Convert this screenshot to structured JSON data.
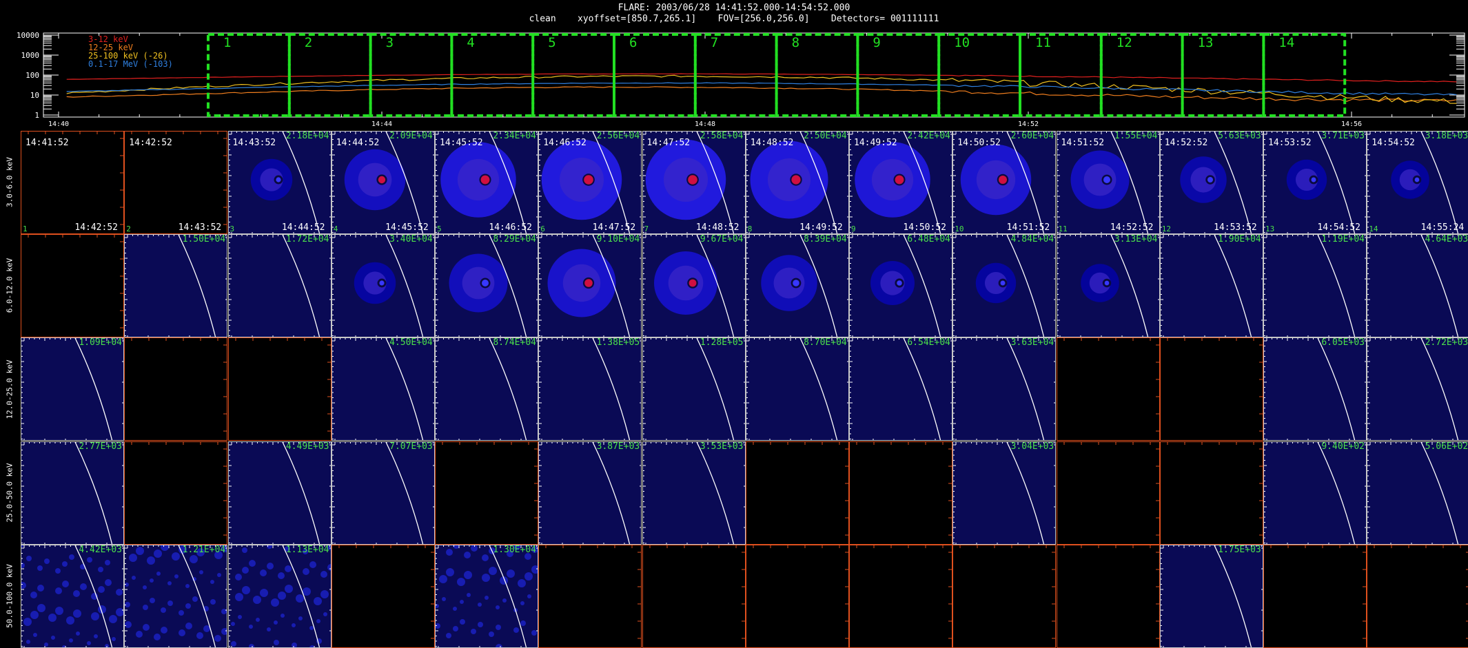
{
  "header": {
    "line1": "FLARE: 2003/06/28 14:41:52.000-14:54:52.000",
    "line2": "clean    xyoffset=[850.7,265.1]    FOV=[256.0,256.0]    Detectors= 001111111"
  },
  "lightcurve": {
    "y_ticks": [
      "10000",
      "1000",
      "100",
      "10",
      "1"
    ],
    "x_ticks": [
      "14:40",
      "14:44",
      "14:48",
      "14:52",
      "14:56"
    ],
    "legend": [
      {
        "label": "3-12 keV",
        "color": "#e0201e"
      },
      {
        "label": "12-25 keV",
        "color": "#f07e1e"
      },
      {
        "label": "25-100 keV (-26)",
        "color": "#f0c020"
      },
      {
        "label": "0.1-17 MeV (-103)",
        "color": "#2f80e0"
      }
    ],
    "interval_color": "#22e022",
    "intervals": [
      "1",
      "2",
      "3",
      "4",
      "5",
      "6",
      "7",
      "8",
      "9",
      "10",
      "11",
      "12",
      "13",
      "14"
    ]
  },
  "rows": [
    {
      "label": "3.0-6.0 keV"
    },
    {
      "label": "6.0-12.0 keV"
    },
    {
      "label": "12.0-25.0 keV"
    },
    {
      "label": "25.0-50.0 keV"
    },
    {
      "label": "50.0-100.0 keV"
    }
  ],
  "time_starts": [
    "14:41:52",
    "14:42:52",
    "14:43:52",
    "14:44:52",
    "14:45:52",
    "14:46:52",
    "14:47:52",
    "14:48:52",
    "14:49:52",
    "14:50:52",
    "14:51:52",
    "14:52:52",
    "14:53:52",
    "14:54:52"
  ],
  "time_ends": [
    "14:42:52",
    "14:43:52",
    "14:44:52",
    "14:45:52",
    "14:46:52",
    "14:47:52",
    "14:48:52",
    "14:49:52",
    "14:50:52",
    "14:51:52",
    "14:52:52",
    "14:53:52",
    "14:54:52",
    "14:55:24"
  ],
  "peaks": [
    [
      "",
      "",
      "2.18E+04",
      "2.09E+04",
      "2.34E+04",
      "2.56E+04",
      "2.58E+04",
      "2.50E+04",
      "2.42E+04",
      "2.60E+04",
      "1.55E+04",
      "5.63E+03",
      "3.71E+03",
      "3.18E+03"
    ],
    [
      "",
      "1.50E+04",
      "1.72E+04",
      "3.40E+04",
      "8.29E+04",
      "9.10E+04",
      "9.67E+04",
      "8.39E+04",
      "6.48E+04",
      "4.84E+04",
      "3.13E+04",
      "1.90E+04",
      "1.19E+04",
      "4.64E+03"
    ],
    [
      "1.09E+04",
      "",
      "",
      "4.50E+04",
      "8.74E+04",
      "1.38E+05",
      "1.28E+05",
      "8.70E+04",
      "6.54E+04",
      "3.63E+04",
      "",
      "",
      "6.05E+03",
      "2.72E+03"
    ],
    [
      "2.77E+03",
      "",
      "4.49E+03",
      "7.07E+03",
      "",
      "3.87E+03",
      "3.53E+03",
      "",
      "",
      "3.04E+03",
      "",
      "",
      "9.40E+02",
      "5.06E+02"
    ],
    [
      "4.42E+03",
      "1.21E+04",
      "1.13E+04",
      "",
      "1.30E+04",
      "",
      "",
      "",
      "",
      "",
      "",
      "1.75E+03",
      "",
      ""
    ]
  ],
  "cells": [
    [
      "E",
      "E",
      "I",
      "I",
      "I",
      "I",
      "I",
      "I",
      "I",
      "I",
      "I",
      "I",
      "I",
      "I"
    ],
    [
      "E",
      "I",
      "I",
      "I",
      "I",
      "I",
      "I",
      "I",
      "I",
      "I",
      "I",
      "I",
      "I",
      "I"
    ],
    [
      "I",
      "E",
      "E",
      "I",
      "I",
      "I",
      "I",
      "I",
      "I",
      "I",
      "E",
      "E",
      "I",
      "I"
    ],
    [
      "I",
      "E",
      "I",
      "I",
      "E",
      "I",
      "I",
      "E",
      "E",
      "I",
      "E",
      "E",
      "I",
      "I"
    ],
    [
      "I",
      "I",
      "I",
      "E",
      "I",
      "E",
      "E",
      "E",
      "E",
      "E",
      "E",
      "I",
      "E",
      "E"
    ]
  ],
  "intensity": [
    [
      0,
      0,
      0.15,
      0.55,
      0.85,
      0.95,
      0.95,
      0.9,
      0.85,
      0.75,
      0.5,
      0.25,
      0.12,
      0.08
    ],
    [
      0,
      0,
      0,
      0.15,
      0.5,
      0.7,
      0.6,
      0.45,
      0.2,
      0.12,
      0.08,
      0,
      0,
      0
    ],
    [
      0,
      0,
      0,
      0,
      0,
      0,
      0,
      0,
      0,
      0,
      0,
      0,
      0,
      0
    ],
    [
      0,
      0,
      0,
      0,
      0,
      0,
      0,
      0,
      0,
      0,
      0,
      0,
      0,
      0
    ],
    [
      0.5,
      0.5,
      0.5,
      0,
      0.35,
      0,
      0,
      0,
      0,
      0,
      0,
      0,
      0,
      0
    ]
  ]
}
